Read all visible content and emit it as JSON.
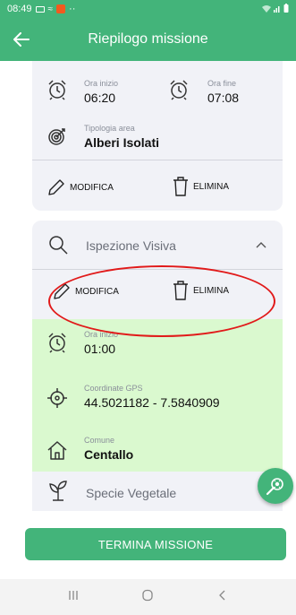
{
  "status_bar": {
    "time": "08:49",
    "dots": "··"
  },
  "app_bar": {
    "title": "Riepilogo missione"
  },
  "card1": {
    "start": {
      "label": "Ora inizio",
      "value": "06:20"
    },
    "end": {
      "label": "Ora fine",
      "value": "07:08"
    },
    "area": {
      "label": "Tipologia area",
      "value": "Alberi Isolati"
    },
    "edit_label": "MODIFICA",
    "delete_label": "ELIMINA"
  },
  "ispezione": {
    "title": "Ispezione Visiva",
    "edit_label": "MODIFICA",
    "delete_label": "ELIMINA",
    "start": {
      "label": "Ora inizio",
      "value": "01:00"
    },
    "gps": {
      "label": "Coordinate GPS",
      "value": "44.5021182 - 7.5840909"
    },
    "comune": {
      "label": "Comune",
      "value": "Centallo"
    }
  },
  "specie": {
    "title": "Specie Vegetale"
  },
  "termina_button": "TERMINA MISSIONE",
  "colors": {
    "primary": "#43b47a",
    "card": "#f1f2f7",
    "highlight": "#daf9cf",
    "annotation": "#e11a1a"
  },
  "icons": [
    "back-arrow-icon",
    "alarm-clock-icon",
    "target-icon",
    "pencil-icon",
    "trash-icon",
    "search-icon",
    "chevron-up-icon",
    "crosshair-icon",
    "house-icon",
    "plant-icon",
    "magnifier-bug-icon"
  ]
}
